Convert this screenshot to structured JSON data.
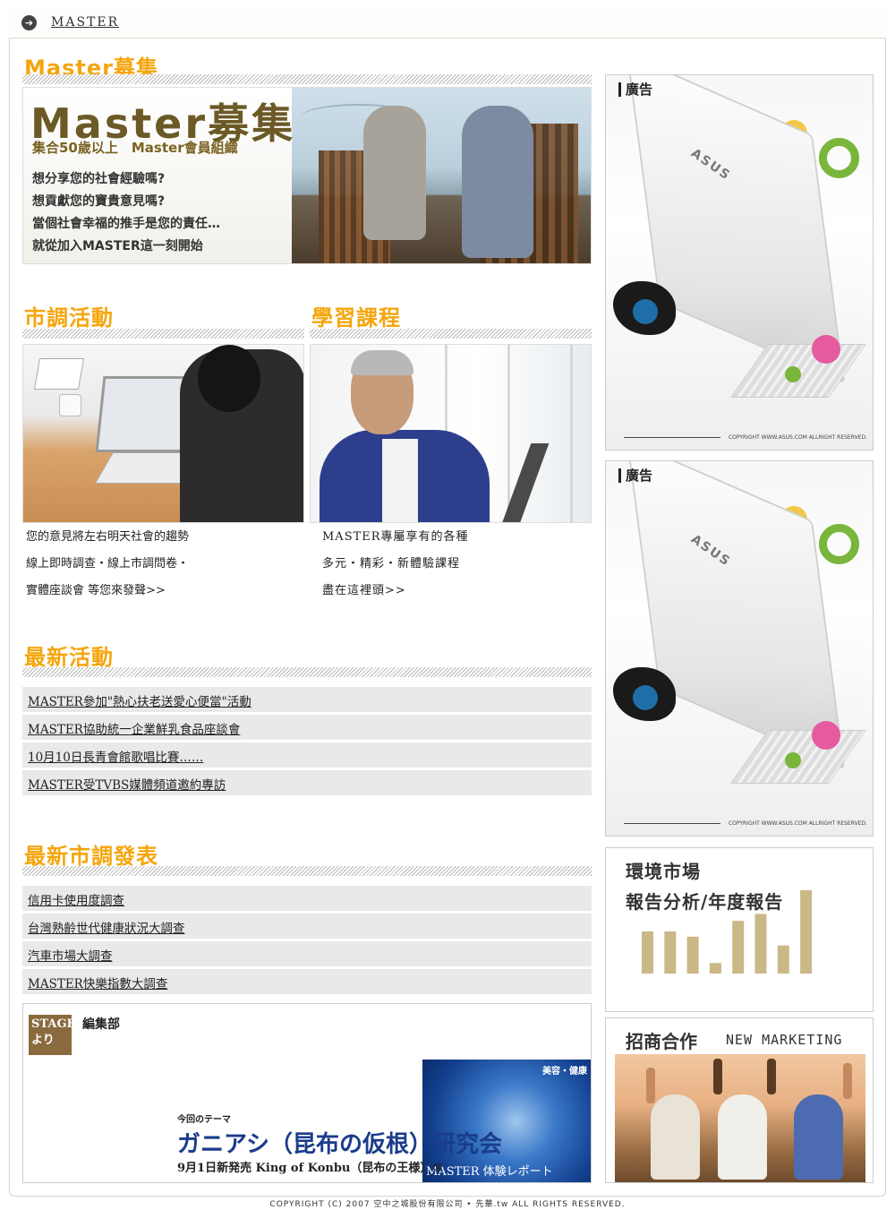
{
  "breadcrumb": {
    "label": "MASTER"
  },
  "sections": {
    "master_recruit": "Master募集",
    "survey": "市調活動",
    "learning": "學習課程",
    "news": "最新活動",
    "survey_reports": "最新市調發表"
  },
  "hero": {
    "title": "Master募集",
    "subtitle": "集合50歲以上　Master會員組織",
    "lines": [
      "想分享您的社會經驗嗎?",
      "想貢獻您的寶貴意見嗎?",
      "當個社會幸福的推手是您的責任…",
      "就從加入MASTER這一刻開始"
    ]
  },
  "survey_desc": [
    "您的意見將左右明天社會的趨勢",
    "線上即時調查・線上市調問卷・",
    "實體座談會 等您來發聲>>"
  ],
  "learning_desc": [
    "MASTER專屬享有的各種",
    "多元・精彩・新體驗課程",
    "盡在這裡頭>>"
  ],
  "news_items": [
    "MASTER參加\"熱心扶老送愛心便當\"活動",
    "MASTER協助統一企業鮮乳食品座談會",
    "10月10日長青會館歌唱比賽……",
    "MASTER受TVBS媒體頻道邀約專訪"
  ],
  "report_items": [
    "信用卡使用度調查",
    "台灣熟齡世代健康狀況大調查",
    "汽車市場大調查",
    "MASTER快樂指數大調查"
  ],
  "stage": {
    "logo_line1": "STAGE",
    "logo_line2": "より",
    "dept": "編集部",
    "theme_label": "今回のテーマ",
    "theme": "ガニアシ（昆布の仮根）研究会",
    "theme_sub": "9月1日新発売 King of Konbu（昆布の王様）®",
    "tag": "美容・健康",
    "report": "MASTER 体験レポート"
  },
  "sidebar": {
    "ad_label": "廣告",
    "ad_brand": "ASUS",
    "ad_copyright": "COPYRIGHT  WWW.ASUS.COM  ALLRIGHT RESERVED.",
    "env_title1": "環境市場",
    "env_title2": "報告分析/年度報告",
    "env_bars": [
      0.48,
      0.48,
      0.42,
      0.12,
      0.6,
      0.68,
      0.32,
      0.95
    ],
    "coop_title": "招商合作",
    "coop_sub": "NEW MARKETING"
  },
  "footer": {
    "text": "COPYRIGHT (C) 2007 空中之城股份有限公司 • 先華.tw ALL RIGHTS RESERVED."
  },
  "colors": {
    "accent": "#f5a50c",
    "row_bg": "#e9e9e9",
    "bar": "#cbb887"
  }
}
